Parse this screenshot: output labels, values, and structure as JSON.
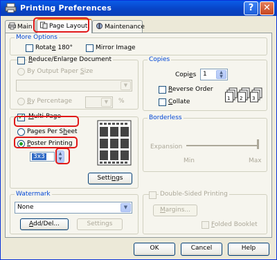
{
  "window": {
    "title": "Printing Preferences",
    "help_glyph": "?",
    "close_glyph": "✕"
  },
  "tabs": [
    {
      "label": "Main",
      "icon": "printer-icon"
    },
    {
      "label": "Page Layout",
      "icon": "page-layout-icon"
    },
    {
      "label": "Maintenance",
      "icon": "maintenance-icon"
    }
  ],
  "more_options": {
    "label": "More Options",
    "rotate_pre": "Rotat",
    "rotate_u": "e",
    "rotate_post": " 180°",
    "mirror_pre": "Mirror Ima",
    "mirror_u": "g",
    "mirror_post": "e"
  },
  "reduce_enlarge": {
    "label_pre": "",
    "label_u": "R",
    "label_post": "educe/Enlarge Document",
    "by_paper_pre": "By Output Paper ",
    "by_paper_u": "S",
    "by_paper_post": "ize",
    "by_pct_pre": "",
    "by_pct_u": "B",
    "by_pct_post": "y Percentage",
    "pct_unit": "%"
  },
  "multipage": {
    "label_pre": "",
    "label_u": "M",
    "label_post": "ulti-Page",
    "pps_pre": "Pages Per S",
    "pps_u": "h",
    "pps_post": "eet",
    "poster_pre": "",
    "poster_u": "P",
    "poster_post": "oster Printing",
    "poster_value": "3x3",
    "settings_pre": "Setti",
    "settings_u": "n",
    "settings_post": "gs"
  },
  "copies": {
    "label": "Copies",
    "copies_pre": "Copi",
    "copies_u": "e",
    "copies_post": "s",
    "copies_value": "1",
    "reverse_pre": "",
    "reverse_u": "R",
    "reverse_post": "everse Order",
    "collate_pre": "",
    "collate_u": "C",
    "collate_post": "ollate"
  },
  "borderless": {
    "label": "Borderless",
    "expansion": "Expansion",
    "min": "Min",
    "max": "Max"
  },
  "watermark": {
    "label": "Watermark",
    "selected": "None",
    "add_pre": "",
    "add_u": "A",
    "add_post": "dd/Del...",
    "settings": "Settings"
  },
  "double_sided": {
    "label": "Double-Sided Printing",
    "margins_pre": "",
    "margins_u": "M",
    "margins_post": "argins...",
    "folded_pre": "",
    "folded_u": "F",
    "folded_post": "olded Booklet"
  },
  "footer": {
    "ok": "OK",
    "cancel": "Cancel",
    "help": "Help"
  },
  "colors": {
    "highlight": "#e01818",
    "accent_check": "#21a121",
    "title_blue": "#0046d5"
  }
}
